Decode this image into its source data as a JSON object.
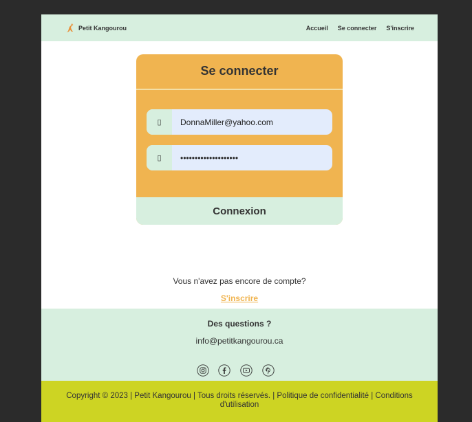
{
  "header": {
    "brand_name": "Petit Kangourou",
    "nav": [
      "Accueil",
      "Se connecter",
      "S'inscrire"
    ]
  },
  "login": {
    "title": "Se connecter",
    "email_icon": "envelope-icon",
    "email_value": "DonnaMiller@yahoo.com",
    "password_icon": "lock-icon",
    "password_value": "••••••••••••••••••••",
    "submit_label": "Connexion"
  },
  "signup": {
    "prompt": "Vous n'avez pas encore de compte?",
    "link": "S'inscrire"
  },
  "footer": {
    "title": "Des questions ?",
    "email": "info@petitkangourou.ca",
    "socials": [
      "instagram-icon",
      "facebook-icon",
      "youtube-icon",
      "pinterest-icon"
    ],
    "copyright": "Copyright © 2023 | Petit Kangourou | Tous droits réservés. | Politique de confidentialité | Conditions d'utilisation"
  },
  "colors": {
    "header_bg": "#d7efdf",
    "card_bg": "#f0b450",
    "input_bg": "#e3ecfc",
    "copyright_bg": "#cdd423",
    "link": "#f0b450"
  }
}
